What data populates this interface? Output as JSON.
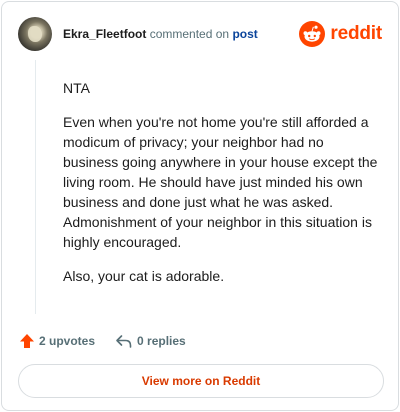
{
  "comment": {
    "username": "Ekra_Fleetfoot",
    "action_text": "commented on",
    "post_link_label": "post",
    "paragraphs": [
      "NTA",
      "Even when you're not home you're still afforded a modicum of privacy; your neighbor had no business going anywhere in your house except the living room. He should have just minded his own business and done just what he was asked. Admonishment of your neighbor in this situation is highly encouraged.",
      "Also, your cat is adorable."
    ],
    "upvotes_label": "2 upvotes",
    "replies_label": "0 replies"
  },
  "brand": {
    "wordmark": "reddit",
    "icon": "reddit-snoo-icon",
    "color": "#ff4500"
  },
  "footer": {
    "view_more_label": "View more on Reddit"
  },
  "colors": {
    "upvote": "#ff4500",
    "muted": "#576f76",
    "link": "#0a449b",
    "button_text": "#d93a00"
  }
}
